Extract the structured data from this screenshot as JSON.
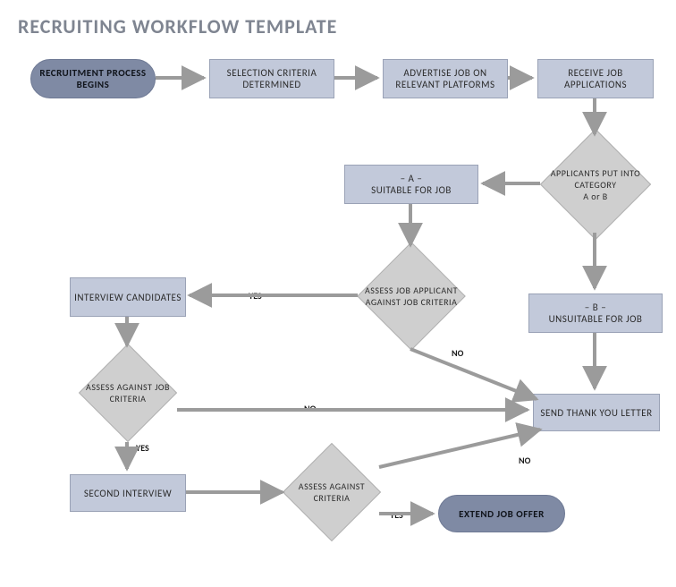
{
  "title": "RECRUITING WORKFLOW TEMPLATE",
  "nodes": {
    "start": "RECRUITMENT PROCESS BEGINS",
    "selection": "SELECTION CRITERIA DETERMINED",
    "advertise": "ADVERTISE JOB ON RELEVANT PLATFORMS",
    "receive": "RECEIVE JOB APPLICATIONS",
    "category": "APPLICANTS PUT INTO CATEGORY\nA or B",
    "catA": "– A –\nSUITABLE FOR JOB",
    "catB": "– B –\nUNSUITABLE FOR JOB",
    "assess1": "ASSESS JOB APPLICANT AGAINST JOB CRITERIA",
    "interview": "INTERVIEW CANDIDATES",
    "assess2": "ASSESS AGAINST JOB CRITERIA",
    "second": "SECOND INTERVIEW",
    "assess3": "ASSESS AGAINST CRITERIA",
    "thank": "SEND THANK YOU LETTER",
    "offer": "EXTEND JOB OFFER"
  },
  "labels": {
    "yes": "YES",
    "no": "NO"
  }
}
